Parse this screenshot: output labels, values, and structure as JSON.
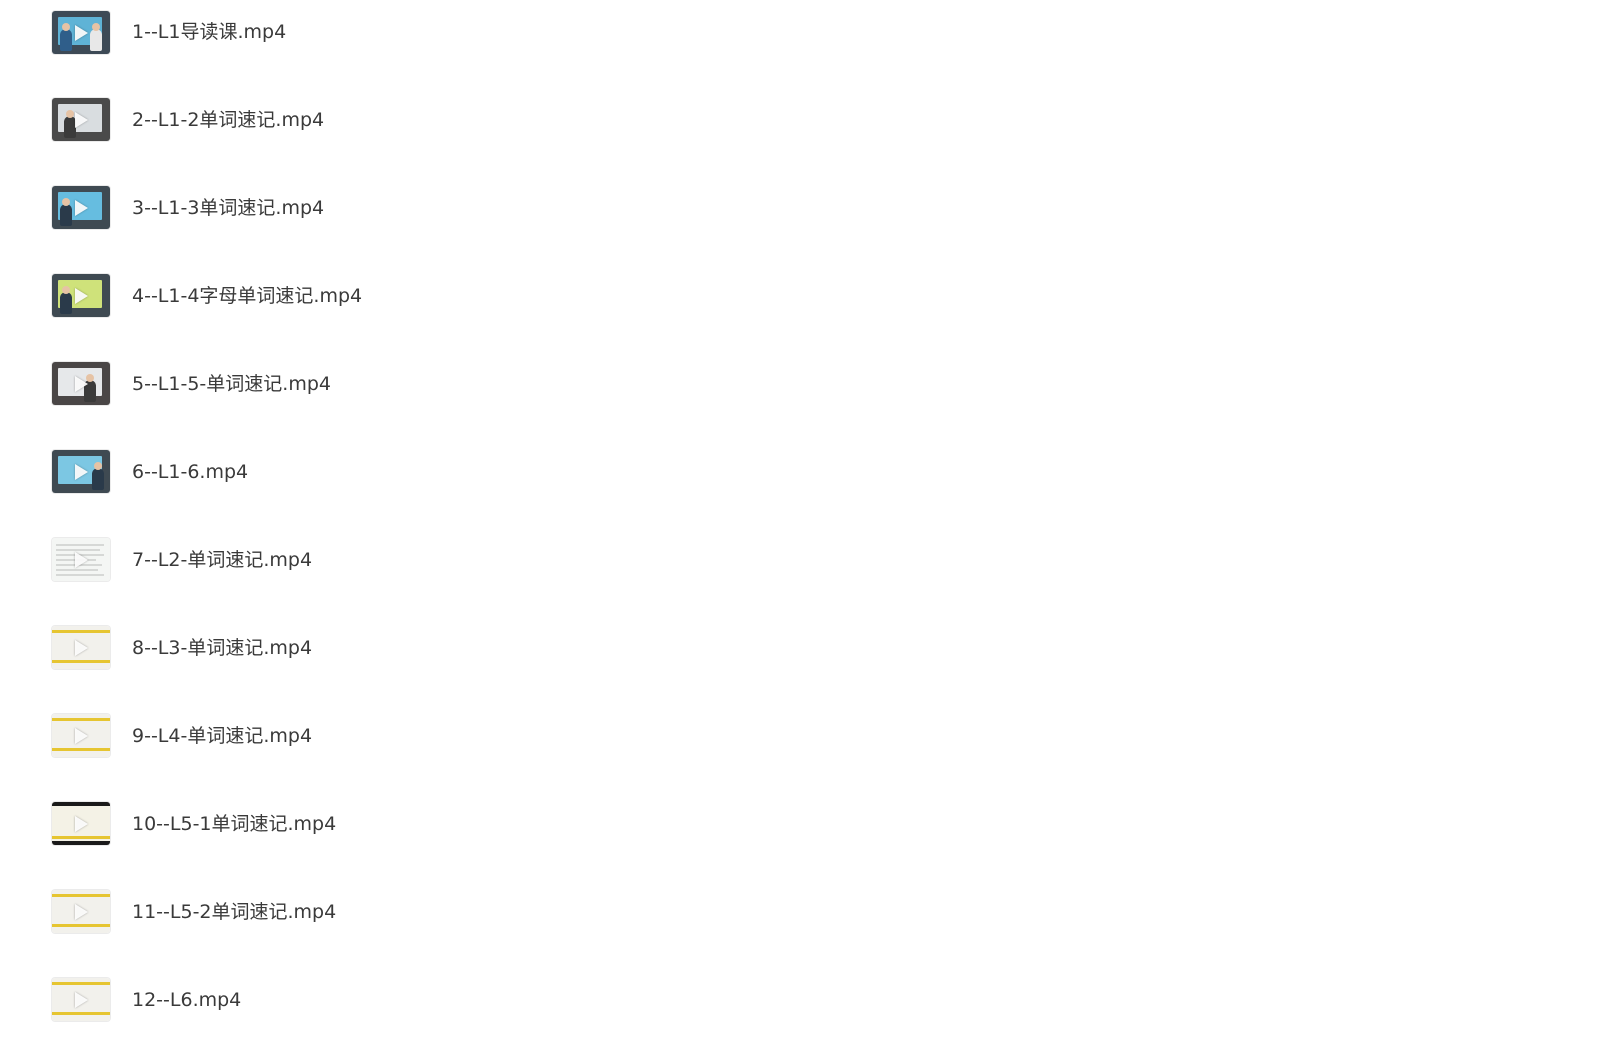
{
  "files": [
    {
      "name": "1--L1导读课.mp4",
      "thumb": "classroom"
    },
    {
      "name": "2--L1-2单词速记.mp4",
      "thumb": "classroom"
    },
    {
      "name": "3--L1-3单词速记.mp4",
      "thumb": "classroom"
    },
    {
      "name": "4--L1-4字母单词速记.mp4",
      "thumb": "classroom"
    },
    {
      "name": "5--L1-5-单词速记.mp4",
      "thumb": "classroom"
    },
    {
      "name": "6--L1-6.mp4",
      "thumb": "classroom"
    },
    {
      "name": "7--L2-单词速记.mp4",
      "thumb": "spreadsheet"
    },
    {
      "name": "8--L3-单词速记.mp4",
      "thumb": "slide"
    },
    {
      "name": "9--L4-单词速记.mp4",
      "thumb": "slide"
    },
    {
      "name": "10--L5-1单词速记.mp4",
      "thumb": "slide-dark"
    },
    {
      "name": "11--L5-2单词速记.mp4",
      "thumb": "slide"
    },
    {
      "name": "12--L6.mp4",
      "thumb": "slide"
    }
  ],
  "icons": {
    "play": "play-icon"
  }
}
